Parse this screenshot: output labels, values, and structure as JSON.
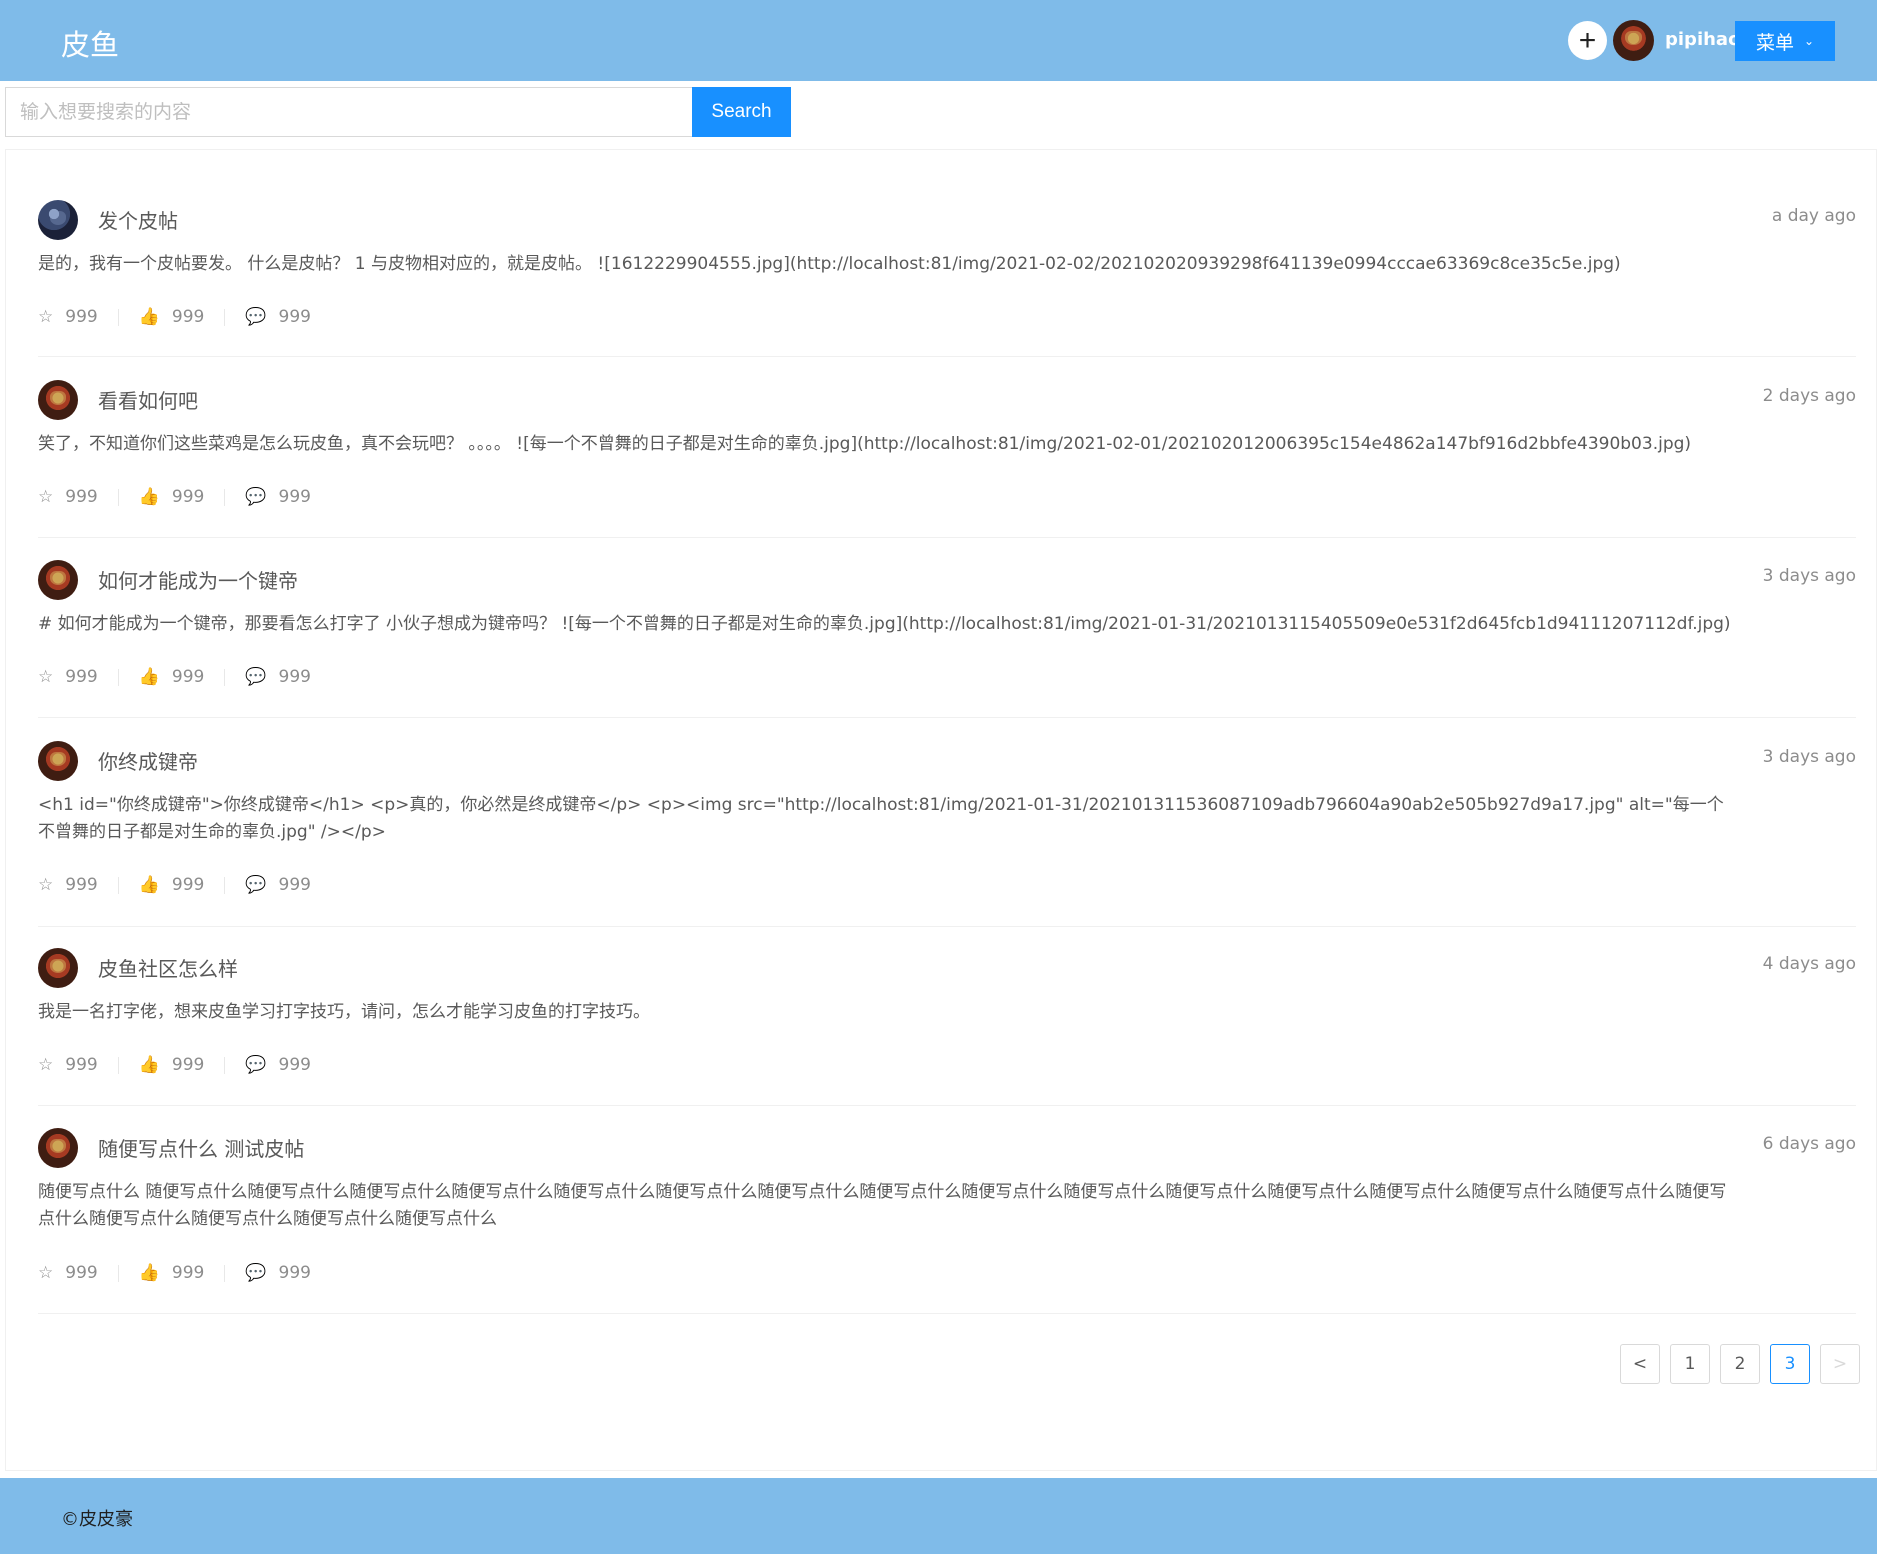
{
  "header": {
    "brand": "皮鱼",
    "add_symbol": "+",
    "username": "pipihao",
    "menu_label": "菜单",
    "menu_chevron": "⌄"
  },
  "search": {
    "placeholder": "输入想要搜索的内容",
    "value": "",
    "button_label": "Search"
  },
  "icons": {
    "star": "☆",
    "like": "👍",
    "comment": "💬"
  },
  "posts": [
    {
      "avatar": "dark",
      "title": "发个皮帖",
      "time": "a day ago",
      "body": "是的，我有一个皮帖要发。 什么是皮帖？ 1 与皮物相对应的，就是皮帖。 ![1612229904555.jpg](http://localhost:81/img/2021-02-02/202102020939298f641139e0994cccae63369c8ce35c5e.jpg)",
      "stars": "999",
      "likes": "999",
      "comments": "999"
    },
    {
      "avatar": "red",
      "title": "看看如何吧",
      "time": "2 days ago",
      "body": "笑了，不知道你们这些菜鸡是怎么玩皮鱼，真不会玩吧？ 。。。。 ![每一个不曾舞的日子都是对生命的辜负.jpg](http://localhost:81/img/2021-02-01/202102012006395c154e4862a147bf916d2bbfe4390b03.jpg)",
      "stars": "999",
      "likes": "999",
      "comments": "999"
    },
    {
      "avatar": "red",
      "title": "如何才能成为一个键帝",
      "time": "3 days ago",
      "body": "# 如何才能成为一个键帝，那要看怎么打字了 小伙子想成为键帝吗？ ![每一个不曾舞的日子都是对生命的辜负.jpg](http://localhost:81/img/2021-01-31/2021013115405509e0e531f2d645fcb1d94111207112df.jpg)",
      "stars": "999",
      "likes": "999",
      "comments": "999"
    },
    {
      "avatar": "red",
      "title": "你终成键帝",
      "time": "3 days ago",
      "body": "<h1 id=\"你终成键帝\">你终成键帝</h1> <p>真的，你必然是终成键帝</p> <p><img src=\"http://localhost:81/img/2021-01-31/202101311536087109adb796604a90ab2e505b927d9a17.jpg\" alt=\"每一个不曾舞的日子都是对生命的辜负.jpg\" /></p>",
      "stars": "999",
      "likes": "999",
      "comments": "999"
    },
    {
      "avatar": "red",
      "title": "皮鱼社区怎么样",
      "time": "4 days ago",
      "body": "我是一名打字佬，想来皮鱼学习打字技巧，请问，怎么才能学习皮鱼的打字技巧。",
      "stars": "999",
      "likes": "999",
      "comments": "999"
    },
    {
      "avatar": "red",
      "title": "随便写点什么 测试皮帖",
      "time": "6 days ago",
      "body": "随便写点什么 随便写点什么随便写点什么随便写点什么随便写点什么随便写点什么随便写点什么随便写点什么随便写点什么随便写点什么随便写点什么随便写点什么随便写点什么随便写点什么随便写点什么随便写点什么随便写点什么随便写点什么随便写点什么随便写点什么随便写点什么",
      "stars": "999",
      "likes": "999",
      "comments": "999"
    }
  ],
  "pagination": {
    "prev": "<",
    "pages": [
      "1",
      "2",
      "3"
    ],
    "current": "3",
    "next": ">"
  },
  "footer": {
    "copyright": "©皮皮豪"
  }
}
